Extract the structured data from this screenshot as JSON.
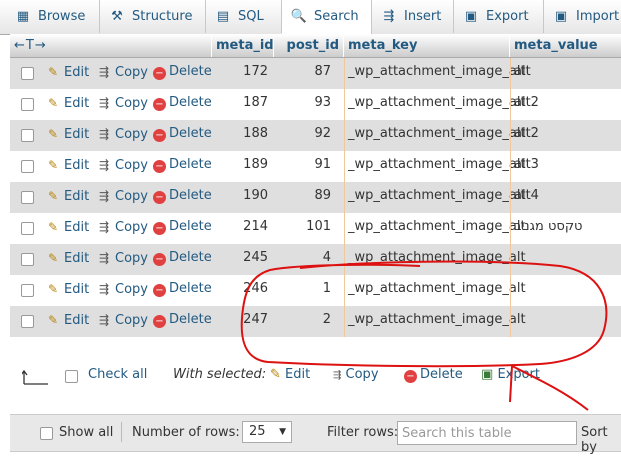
{
  "tabs": [
    {
      "label": "Browse",
      "icon": "browse-icon",
      "glyph": "▦"
    },
    {
      "label": "Structure",
      "icon": "structure-icon",
      "glyph": "⚒"
    },
    {
      "label": "SQL",
      "icon": "sql-icon",
      "glyph": "▤"
    },
    {
      "label": "Search",
      "icon": "search-icon",
      "glyph": "🔍"
    },
    {
      "label": "Insert",
      "icon": "insert-icon",
      "glyph": "⇶"
    },
    {
      "label": "Export",
      "icon": "export-icon",
      "glyph": "▣"
    },
    {
      "label": "Import",
      "icon": "import-icon",
      "glyph": "▣"
    }
  ],
  "header": {
    "arrows": "←T→",
    "columns": [
      "meta_id",
      "post_id",
      "meta_key",
      "meta_value"
    ]
  },
  "actions": {
    "edit": "Edit",
    "copy": "Copy",
    "delete": "Delete"
  },
  "rows": [
    {
      "meta_id": "172",
      "post_id": "87",
      "meta_key": "_wp_attachment_image_alt",
      "meta_value": "alt"
    },
    {
      "meta_id": "187",
      "post_id": "93",
      "meta_key": "_wp_attachment_image_alt",
      "meta_value": "alt2"
    },
    {
      "meta_id": "188",
      "post_id": "92",
      "meta_key": "_wp_attachment_image_alt",
      "meta_value": "alt2"
    },
    {
      "meta_id": "189",
      "post_id": "91",
      "meta_key": "_wp_attachment_image_alt",
      "meta_value": "alt3"
    },
    {
      "meta_id": "190",
      "post_id": "89",
      "meta_key": "_wp_attachment_image_alt",
      "meta_value": "alt4"
    },
    {
      "meta_id": "214",
      "post_id": "101",
      "meta_key": "_wp_attachment_image_alt",
      "meta_value": "טקסט מגניב"
    },
    {
      "meta_id": "245",
      "post_id": "4",
      "meta_key": "_wp_attachment_image_alt",
      "meta_value": ""
    },
    {
      "meta_id": "246",
      "post_id": "1",
      "meta_key": "_wp_attachment_image_alt",
      "meta_value": ""
    },
    {
      "meta_id": "247",
      "post_id": "2",
      "meta_key": "_wp_attachment_image_alt",
      "meta_value": ""
    }
  ],
  "bulk": {
    "check_all": "Check all",
    "with_selected": "With selected:",
    "edit": "Edit",
    "copy": "Copy",
    "delete": "Delete",
    "export": "Export"
  },
  "nav": {
    "show_all": "Show all",
    "rows_label": "Number of rows:",
    "rows_value": "25",
    "filter_label": "Filter rows:",
    "filter_placeholder": "Search this table",
    "sort_label": "Sort by"
  },
  "colors": {
    "link": "#235a81",
    "annotation": "#dd1111"
  }
}
